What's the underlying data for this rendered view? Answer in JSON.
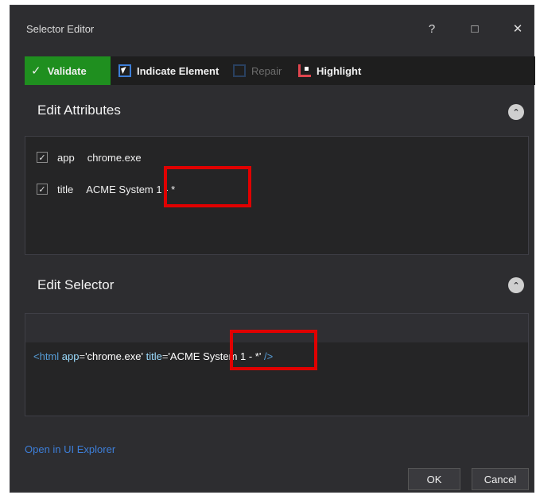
{
  "window": {
    "title": "Selector Editor",
    "help": "?",
    "maximize": "□",
    "close": "✕"
  },
  "toolbar": {
    "validate_label": "Validate",
    "validate_check": "✓",
    "indicate_label": "Indicate Element",
    "repair_label": "Repair",
    "highlight_label": "Highlight"
  },
  "attributes": {
    "title": "Edit Attributes",
    "collapse": "⌃",
    "items": [
      {
        "name": "app",
        "value": "chrome.exe",
        "checked": true,
        "mark": "✓"
      },
      {
        "name": "title",
        "value": "ACME System 1 - *",
        "checked": true,
        "mark": "✓"
      }
    ]
  },
  "selector": {
    "title": "Edit Selector",
    "collapse": "⌃",
    "open_tag": "<html",
    "app_attr": "app",
    "app_val": "'chrome.exe'",
    "title_attr": "title",
    "title_val": "'ACME System 1 - *'",
    "close_tag": "/>"
  },
  "footer": {
    "explorer_link": "Open in UI Explorer",
    "ok_label": "OK",
    "cancel_label": "Cancel"
  },
  "colors": {
    "validate_bg": "#1f8f1f",
    "highlight_red": "#e00000",
    "link_blue": "#3d7ed8"
  }
}
